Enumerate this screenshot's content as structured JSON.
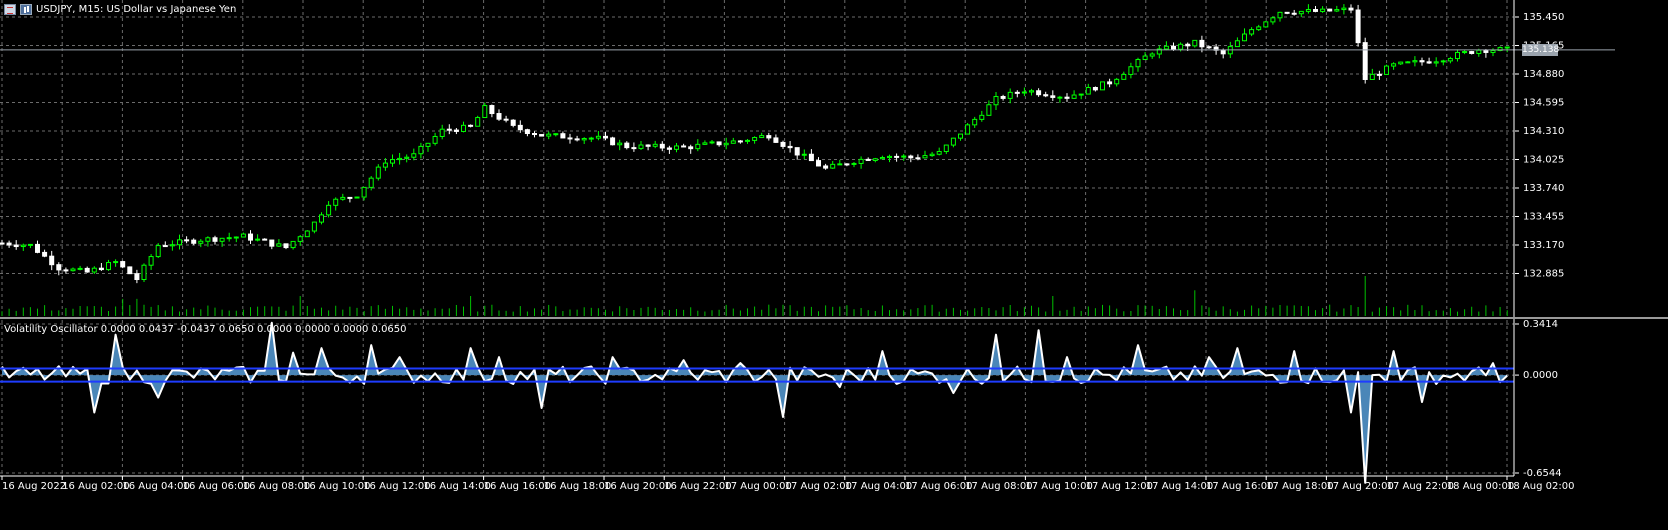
{
  "window": {
    "symbol_title": "USDJPY, M15:  US Dollar vs Japanese Yen"
  },
  "price_axis": {
    "ticks": [
      "135.450",
      "135.165",
      "134.880",
      "134.595",
      "134.310",
      "134.025",
      "133.740",
      "133.455",
      "133.170",
      "132.885"
    ],
    "current_price": "135.138"
  },
  "oscillator": {
    "label": "Volatility Oscillator 0.0000 0.0437 -0.0437 0.0650 0.0000 0.0000 0.0000 0.0650",
    "ticks": [
      "0.3414",
      "0.0000",
      "-0.6544"
    ]
  },
  "time_axis": {
    "labels": [
      "16 Aug 2022",
      "16 Aug 02:00",
      "16 Aug 04:00",
      "16 Aug 06:00",
      "16 Aug 08:00",
      "16 Aug 10:00",
      "16 Aug 12:00",
      "16 Aug 14:00",
      "16 Aug 16:00",
      "16 Aug 18:00",
      "16 Aug 20:00",
      "16 Aug 22:00",
      "17 Aug 00:00",
      "17 Aug 02:00",
      "17 Aug 04:00",
      "17 Aug 06:00",
      "17 Aug 08:00",
      "17 Aug 10:00",
      "17 Aug 12:00",
      "17 Aug 14:00",
      "17 Aug 16:00",
      "17 Aug 18:00",
      "17 Aug 20:00",
      "17 Aug 22:00",
      "18 Aug 00:00",
      "18 Aug 02:00"
    ]
  },
  "colors": {
    "background": "#000000",
    "grid": "#6b6b6b",
    "bull": "#00ff00",
    "bear": "#ffffff",
    "volume": "#00c000",
    "osc_fill": "#4a86b8",
    "osc_line": "#ffffff",
    "band": "#1e3cff"
  },
  "chart_data": {
    "type": "candlestick",
    "path_anchors": [
      [
        0,
        133.42
      ],
      [
        4,
        133.4
      ],
      [
        8,
        133.2
      ],
      [
        12,
        133.16
      ],
      [
        16,
        133.25
      ],
      [
        19,
        133.1
      ],
      [
        22,
        133.4
      ],
      [
        28,
        133.45
      ],
      [
        34,
        133.48
      ],
      [
        40,
        133.38
      ],
      [
        44,
        133.6
      ],
      [
        46,
        133.78
      ],
      [
        50,
        133.85
      ],
      [
        54,
        134.15
      ],
      [
        58,
        134.2
      ],
      [
        62,
        134.42
      ],
      [
        66,
        134.45
      ],
      [
        68,
        134.62
      ],
      [
        72,
        134.45
      ],
      [
        76,
        134.38
      ],
      [
        84,
        134.35
      ],
      [
        88,
        134.28
      ],
      [
        96,
        134.27
      ],
      [
        104,
        134.33
      ],
      [
        108,
        134.38
      ],
      [
        112,
        134.22
      ],
      [
        116,
        134.08
      ],
      [
        120,
        134.15
      ],
      [
        124,
        134.2
      ],
      [
        128,
        134.18
      ],
      [
        132,
        134.22
      ],
      [
        136,
        134.46
      ],
      [
        140,
        134.7
      ],
      [
        144,
        134.78
      ],
      [
        150,
        134.72
      ],
      [
        156,
        134.85
      ],
      [
        162,
        135.12
      ],
      [
        168,
        135.2
      ],
      [
        172,
        135.1
      ],
      [
        176,
        135.32
      ],
      [
        180,
        135.48
      ],
      [
        186,
        135.48
      ],
      [
        190,
        135.5
      ],
      [
        192,
        134.88
      ],
      [
        196,
        135.0
      ],
      [
        202,
        135.05
      ],
      [
        208,
        135.14
      ],
      [
        212,
        135.14
      ]
    ],
    "volume_range": [
      0,
      14000
    ],
    "oscillator": {
      "ylim": [
        -0.6544,
        0.3414
      ],
      "upper_band": 0.0437,
      "lower_band": -0.0437,
      "spikes": [
        [
          16,
          0.27
        ],
        [
          13,
          -0.25
        ],
        [
          22,
          -0.15
        ],
        [
          38,
          0.35
        ],
        [
          41,
          0.15
        ],
        [
          45,
          0.18
        ],
        [
          52,
          0.2
        ],
        [
          56,
          0.12
        ],
        [
          66,
          0.18
        ],
        [
          70,
          0.12
        ],
        [
          76,
          -0.22
        ],
        [
          86,
          0.12
        ],
        [
          96,
          0.1
        ],
        [
          104,
          0.08
        ],
        [
          110,
          -0.28
        ],
        [
          118,
          -0.08
        ],
        [
          124,
          0.16
        ],
        [
          134,
          -0.12
        ],
        [
          140,
          0.27
        ],
        [
          146,
          0.3
        ],
        [
          150,
          0.12
        ],
        [
          160,
          0.2
        ],
        [
          170,
          0.12
        ],
        [
          174,
          0.18
        ],
        [
          182,
          0.16
        ],
        [
          190,
          -0.25
        ],
        [
          192,
          -0.72
        ],
        [
          196,
          0.16
        ],
        [
          200,
          -0.18
        ],
        [
          210,
          0.08
        ]
      ]
    }
  }
}
